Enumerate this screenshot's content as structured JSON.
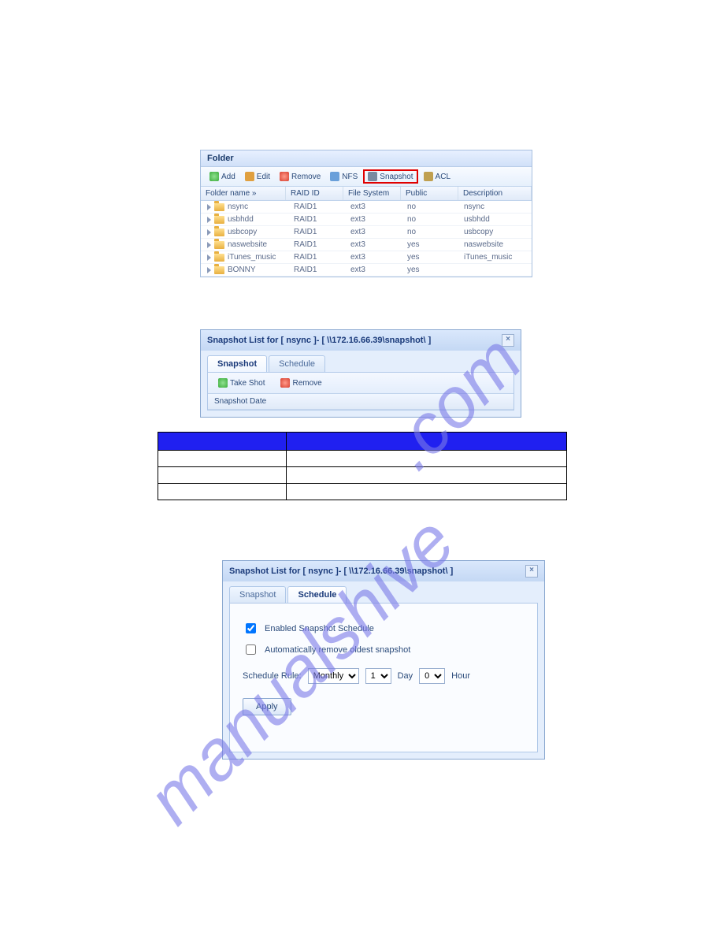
{
  "folder_panel": {
    "title": "Folder",
    "toolbar": {
      "add": "Add",
      "edit": "Edit",
      "remove": "Remove",
      "nfs": "NFS",
      "snapshot": "Snapshot",
      "acl": "ACL"
    },
    "columns": {
      "name": "Folder name »",
      "raid": "RAID ID",
      "fs": "File System",
      "public": "Public",
      "desc": "Description"
    },
    "rows": [
      {
        "name": "nsync",
        "raid": "RAID1",
        "fs": "ext3",
        "public": "no",
        "desc": "nsync"
      },
      {
        "name": "usbhdd",
        "raid": "RAID1",
        "fs": "ext3",
        "public": "no",
        "desc": "usbhdd"
      },
      {
        "name": "usbcopy",
        "raid": "RAID1",
        "fs": "ext3",
        "public": "no",
        "desc": "usbcopy"
      },
      {
        "name": "naswebsite",
        "raid": "RAID1",
        "fs": "ext3",
        "public": "yes",
        "desc": "naswebsite"
      },
      {
        "name": "iTunes_music",
        "raid": "RAID1",
        "fs": "ext3",
        "public": "yes",
        "desc": "iTunes_music"
      },
      {
        "name": "BONNY",
        "raid": "RAID1",
        "fs": "ext3",
        "public": "yes",
        "desc": ""
      }
    ]
  },
  "dialog1": {
    "title": "Snapshot List for [ nsync ]- [ \\\\172.16.66.39\\snapshot\\ ]",
    "tabs": {
      "snapshot": "Snapshot",
      "schedule": "Schedule"
    },
    "buttons": {
      "take": "Take Shot",
      "remove": "Remove"
    },
    "col": "Snapshot Date"
  },
  "dialog2": {
    "title": "Snapshot List for [ nsync ]- [ \\\\172.16.66.39\\snapshot\\ ]",
    "tabs": {
      "snapshot": "Snapshot",
      "schedule": "Schedule"
    },
    "check1": "Enabled Snapshot Schedule",
    "check2": "Automatically remove oldest snapshot",
    "rule_label": "Schedule Rule:",
    "monthly": "Monthly",
    "day_val": "1",
    "day_label": "Day",
    "hour_val": "0",
    "hour_label": "Hour",
    "apply": "Apply"
  },
  "watermark": {
    "a": ".com",
    "b": "manualshive"
  }
}
